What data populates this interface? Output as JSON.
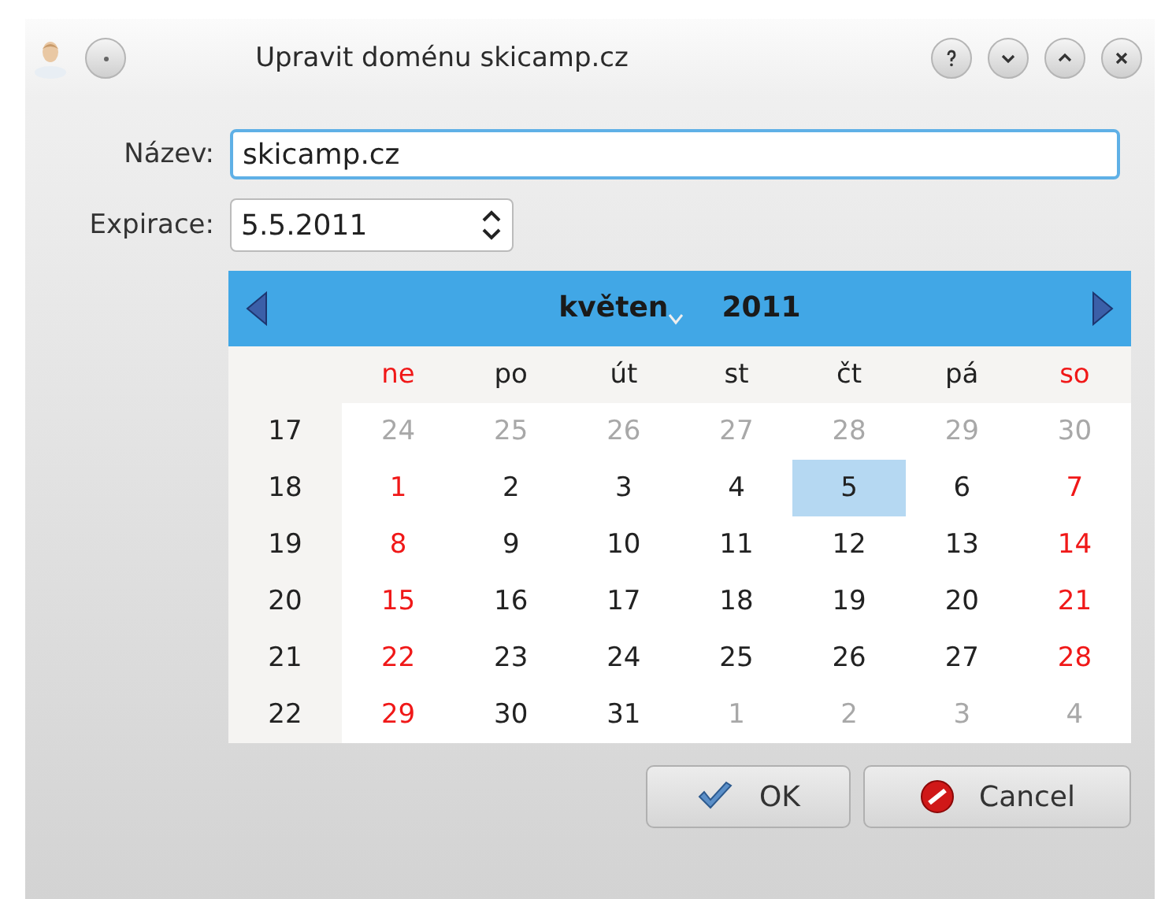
{
  "window": {
    "title": "Upravit doménu skicamp.cz"
  },
  "form": {
    "name_label": "Název:",
    "name_value": "skicamp.cz",
    "expiry_label": "Expirace:",
    "expiry_value": "5.5.2011"
  },
  "calendar": {
    "month": "květen",
    "year": "2011",
    "weekdays": [
      {
        "label": "ne",
        "weekend": true
      },
      {
        "label": "po",
        "weekend": false
      },
      {
        "label": "út",
        "weekend": false
      },
      {
        "label": "st",
        "weekend": false
      },
      {
        "label": "čt",
        "weekend": false
      },
      {
        "label": "pá",
        "weekend": false
      },
      {
        "label": "so",
        "weekend": true
      }
    ],
    "weeks": [
      {
        "number": "17",
        "days": [
          {
            "text": "24",
            "kind": "adjacent",
            "selected": false
          },
          {
            "text": "25",
            "kind": "adjacent",
            "selected": false
          },
          {
            "text": "26",
            "kind": "adjacent",
            "selected": false
          },
          {
            "text": "27",
            "kind": "adjacent",
            "selected": false
          },
          {
            "text": "28",
            "kind": "adjacent",
            "selected": false
          },
          {
            "text": "29",
            "kind": "adjacent",
            "selected": false
          },
          {
            "text": "30",
            "kind": "adjacent",
            "selected": false
          }
        ]
      },
      {
        "number": "18",
        "days": [
          {
            "text": "1",
            "kind": "weekend",
            "selected": false
          },
          {
            "text": "2",
            "kind": "current",
            "selected": false
          },
          {
            "text": "3",
            "kind": "current",
            "selected": false
          },
          {
            "text": "4",
            "kind": "current",
            "selected": false
          },
          {
            "text": "5",
            "kind": "current",
            "selected": true
          },
          {
            "text": "6",
            "kind": "current",
            "selected": false
          },
          {
            "text": "7",
            "kind": "weekend",
            "selected": false
          }
        ]
      },
      {
        "number": "19",
        "days": [
          {
            "text": "8",
            "kind": "weekend",
            "selected": false
          },
          {
            "text": "9",
            "kind": "current",
            "selected": false
          },
          {
            "text": "10",
            "kind": "current",
            "selected": false
          },
          {
            "text": "11",
            "kind": "current",
            "selected": false
          },
          {
            "text": "12",
            "kind": "current",
            "selected": false
          },
          {
            "text": "13",
            "kind": "current",
            "selected": false
          },
          {
            "text": "14",
            "kind": "weekend",
            "selected": false
          }
        ]
      },
      {
        "number": "20",
        "days": [
          {
            "text": "15",
            "kind": "weekend",
            "selected": false
          },
          {
            "text": "16",
            "kind": "current",
            "selected": false
          },
          {
            "text": "17",
            "kind": "current",
            "selected": false
          },
          {
            "text": "18",
            "kind": "current",
            "selected": false
          },
          {
            "text": "19",
            "kind": "current",
            "selected": false
          },
          {
            "text": "20",
            "kind": "current",
            "selected": false
          },
          {
            "text": "21",
            "kind": "weekend",
            "selected": false
          }
        ]
      },
      {
        "number": "21",
        "days": [
          {
            "text": "22",
            "kind": "weekend",
            "selected": false
          },
          {
            "text": "23",
            "kind": "current",
            "selected": false
          },
          {
            "text": "24",
            "kind": "current",
            "selected": false
          },
          {
            "text": "25",
            "kind": "current",
            "selected": false
          },
          {
            "text": "26",
            "kind": "current",
            "selected": false
          },
          {
            "text": "27",
            "kind": "current",
            "selected": false
          },
          {
            "text": "28",
            "kind": "weekend",
            "selected": false
          }
        ]
      },
      {
        "number": "22",
        "days": [
          {
            "text": "29",
            "kind": "weekend",
            "selected": false
          },
          {
            "text": "30",
            "kind": "current",
            "selected": false
          },
          {
            "text": "31",
            "kind": "current",
            "selected": false
          },
          {
            "text": "1",
            "kind": "adjacent",
            "selected": false
          },
          {
            "text": "2",
            "kind": "adjacent",
            "selected": false
          },
          {
            "text": "3",
            "kind": "adjacent",
            "selected": false
          },
          {
            "text": "4",
            "kind": "adjacent",
            "selected": false
          }
        ]
      }
    ]
  },
  "buttons": [
    {
      "label": "OK",
      "kind": "ok"
    },
    {
      "label": "Cancel",
      "kind": "cancel"
    }
  ]
}
